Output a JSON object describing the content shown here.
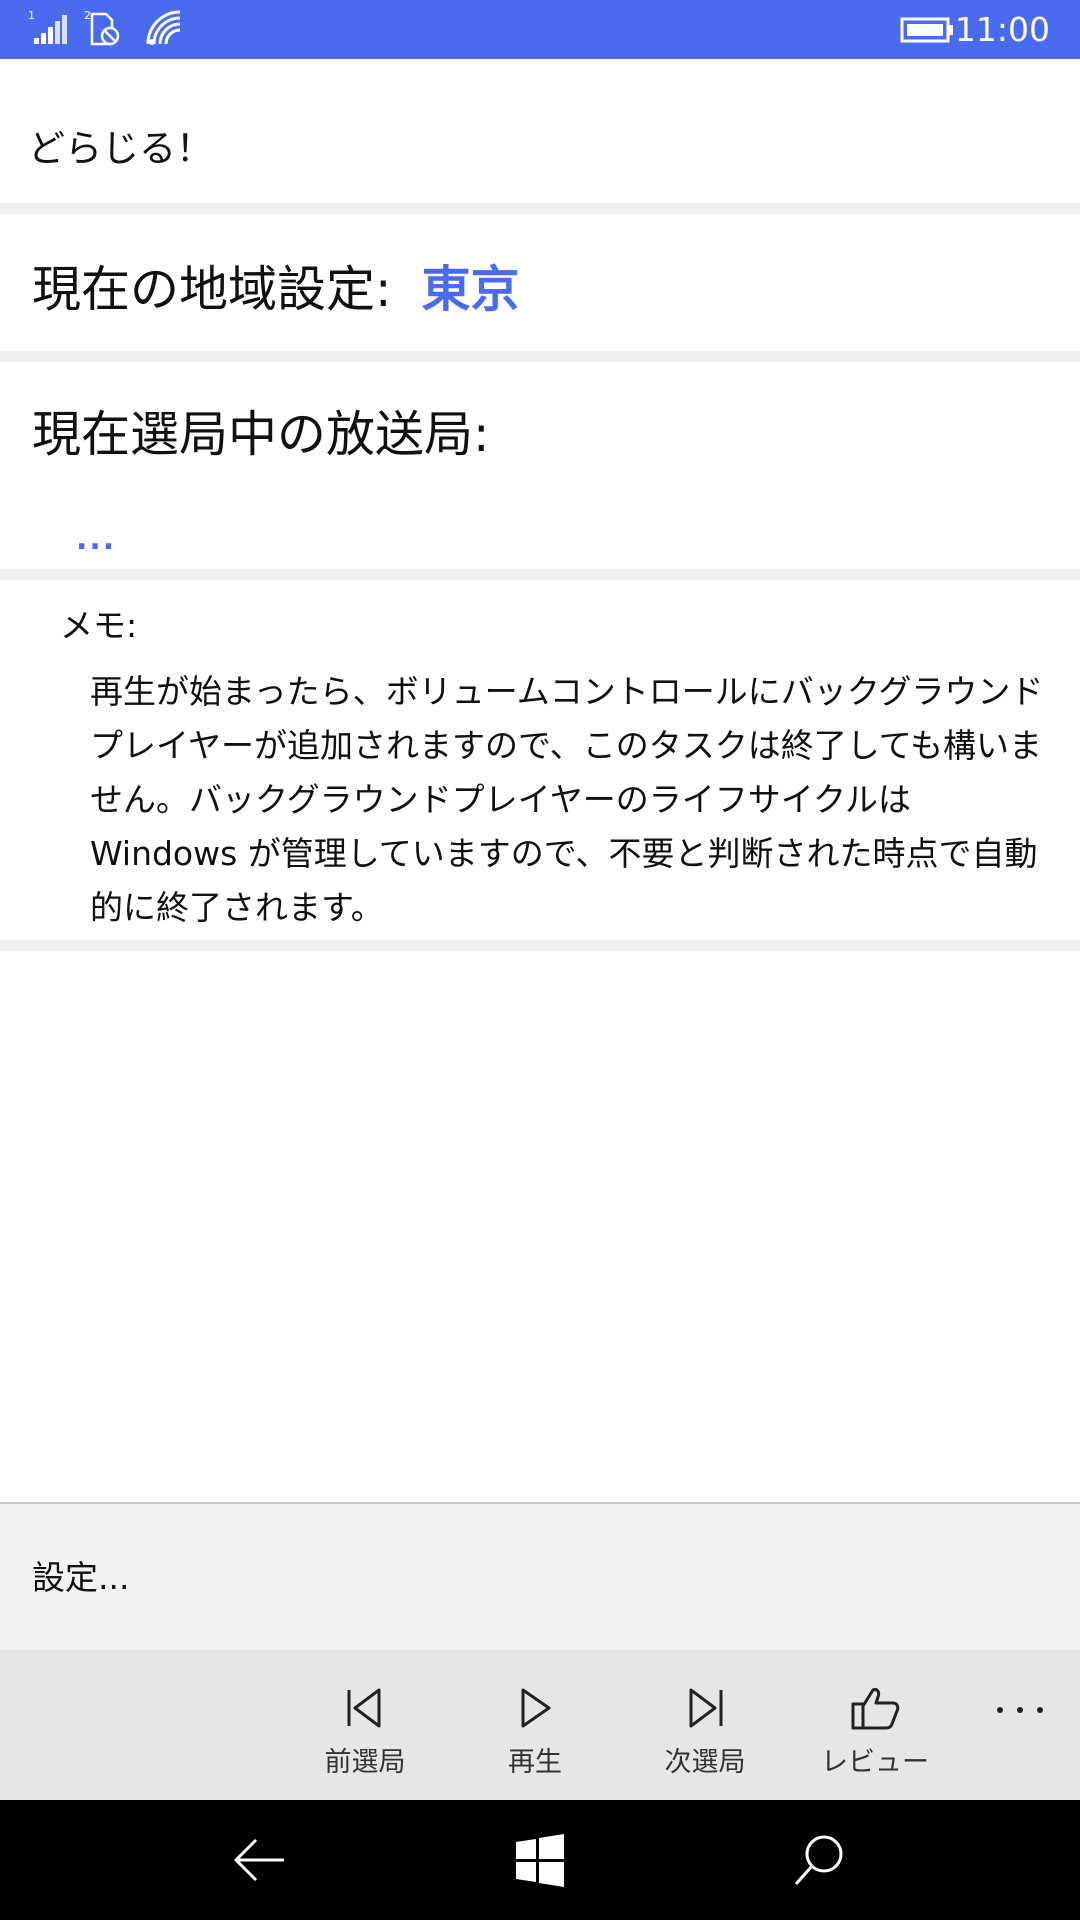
{
  "status_bar": {
    "time": "11:00",
    "icons": [
      "signal-sim1-icon",
      "sim2-no-service-icon",
      "wifi-icon",
      "battery-icon"
    ],
    "background": "#4a6bf0"
  },
  "app": {
    "title": "どらじる！"
  },
  "region": {
    "label": "現在の地域設定:",
    "value": "東京"
  },
  "station": {
    "label": "現在選局中の放送局:",
    "value": "..."
  },
  "memo": {
    "label": "メモ:",
    "text": "再生が始まったら、ボリュームコントロールにバックグラウンドプレイヤーが追加されますので、このタスクは終了しても構いません。バックグラウンドプレイヤーのライフサイクルは Windows が管理していますので、不要と判断された時点で自動的に終了されます。"
  },
  "settings": {
    "label": "設定..."
  },
  "command_bar": {
    "buttons": [
      {
        "label": "前選局",
        "icon": "previous-station-icon"
      },
      {
        "label": "再生",
        "icon": "play-icon"
      },
      {
        "label": "次選局",
        "icon": "next-station-icon"
      },
      {
        "label": "レビュー",
        "icon": "thumbs-up-icon"
      }
    ],
    "more_icon": "more-icon"
  },
  "nav_bar": {
    "icons": [
      "back-icon",
      "windows-start-icon",
      "search-icon"
    ]
  },
  "colors": {
    "accent": "#4a6bf0",
    "separator": "#efefef",
    "command_bar": "#e6e6e6",
    "settings_panel": "#f2f2f2"
  }
}
